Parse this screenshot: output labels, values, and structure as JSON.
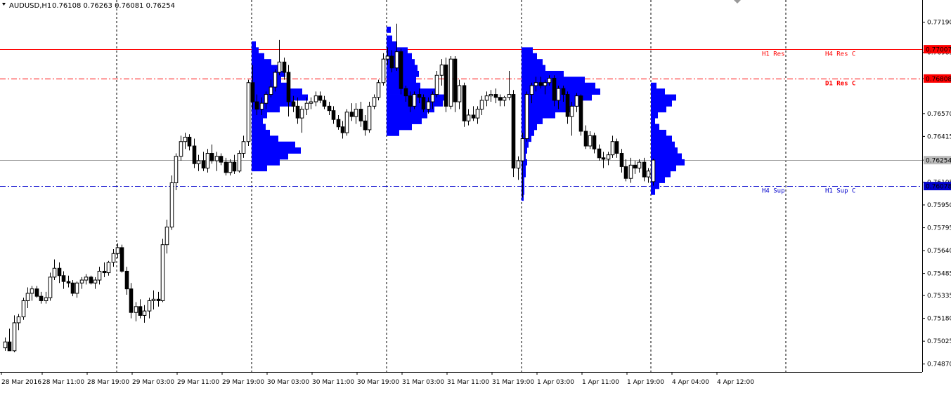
{
  "header": {
    "symbol": "AUDUSD,H1",
    "ohlc": "0.76108 0.76263 0.76081 0.76254"
  },
  "colors": {
    "up_body": "#ffffff",
    "down_body": "#000000",
    "profile": "#0000ff",
    "resistance": "#ff0000",
    "support": "#0000cc",
    "last_price_line": "#999999",
    "session_grid": "#000000"
  },
  "chart_data": {
    "type": "candlestick",
    "timeframe": "H1",
    "ylim": [
      0.7474,
      0.7726
    ],
    "y_ticks": [
      "0.77190",
      "0.76985",
      "0.76808",
      "0.76570",
      "0.76415",
      "0.76254",
      "0.76105",
      "0.75950",
      "0.75795",
      "0.75640",
      "0.75485",
      "0.75335",
      "0.75180",
      "0.75025",
      "0.74870"
    ],
    "x_ticks": [
      "28 Mar 2016",
      "28 Mar 11:00",
      "28 Mar 19:00",
      "29 Mar 03:00",
      "29 Mar 11:00",
      "29 Mar 19:00",
      "30 Mar 03:00",
      "30 Mar 11:00",
      "30 Mar 19:00",
      "31 Mar 03:00",
      "31 Mar 11:00",
      "31 Mar 19:00",
      "1 Apr 03:00",
      "1 Apr 11:00",
      "1 Apr 19:00",
      "4 Apr 04:00",
      "4 Apr 12:00"
    ],
    "session_separators_hour_index": [
      24,
      48,
      72,
      96,
      120,
      144
    ],
    "levels": [
      {
        "price": 0.77007,
        "badge": "0.77007",
        "style": "solid",
        "color": "#ff0000",
        "labels": [
          "H1 Res",
          "H4 Res C"
        ]
      },
      {
        "price": 0.76808,
        "badge": "0.76808",
        "style": "dashdot",
        "color": "#ff0000",
        "labels": [
          "D1 Res C"
        ]
      },
      {
        "price": 0.76254,
        "badge": "0.76254",
        "style": "solid",
        "color": "#999999",
        "labels": []
      },
      {
        "price": 0.76078,
        "badge": "0.76078",
        "style": "dashdot",
        "color": "#0000cc",
        "labels": [
          "H4 Sup",
          "H1 Sup C"
        ]
      }
    ],
    "candles": [
      [
        0.7498,
        0.7505,
        0.7496,
        0.7502
      ],
      [
        0.7502,
        0.7511,
        0.75,
        0.7496
      ],
      [
        0.7496,
        0.752,
        0.7495,
        0.7515
      ],
      [
        0.7515,
        0.7521,
        0.751,
        0.7519
      ],
      [
        0.7519,
        0.7532,
        0.7517,
        0.753
      ],
      [
        0.753,
        0.7539,
        0.7525,
        0.7535
      ],
      [
        0.7535,
        0.754,
        0.753,
        0.7538
      ],
      [
        0.7538,
        0.754,
        0.7532,
        0.7533
      ],
      [
        0.7533,
        0.7536,
        0.7528,
        0.753
      ],
      [
        0.753,
        0.7536,
        0.7528,
        0.7532
      ],
      [
        0.7532,
        0.7549,
        0.753,
        0.7546
      ],
      [
        0.7546,
        0.7558,
        0.7544,
        0.7552
      ],
      [
        0.7552,
        0.7556,
        0.7542,
        0.7547
      ],
      [
        0.7547,
        0.755,
        0.7538,
        0.7543
      ],
      [
        0.7543,
        0.7547,
        0.7539,
        0.7542
      ],
      [
        0.7542,
        0.7544,
        0.7533,
        0.7535
      ],
      [
        0.7535,
        0.7543,
        0.7532,
        0.7542
      ],
      [
        0.7542,
        0.7546,
        0.7538,
        0.7544
      ],
      [
        0.7544,
        0.7548,
        0.7541,
        0.7546
      ],
      [
        0.7546,
        0.7547,
        0.7541,
        0.7542
      ],
      [
        0.7542,
        0.7546,
        0.7538,
        0.7544
      ],
      [
        0.7544,
        0.7553,
        0.7541,
        0.755
      ],
      [
        0.755,
        0.7556,
        0.7546,
        0.7549
      ],
      [
        0.7549,
        0.7557,
        0.7547,
        0.7556
      ],
      [
        0.7556,
        0.7565,
        0.7553,
        0.7562
      ],
      [
        0.7562,
        0.7569,
        0.7559,
        0.7566
      ],
      [
        0.7566,
        0.7568,
        0.7549,
        0.755
      ],
      [
        0.755,
        0.7553,
        0.7534,
        0.7538
      ],
      [
        0.7538,
        0.7542,
        0.7518,
        0.7522
      ],
      [
        0.7522,
        0.7529,
        0.7516,
        0.7526
      ],
      [
        0.7526,
        0.7531,
        0.7518,
        0.752
      ],
      [
        0.752,
        0.7527,
        0.7515,
        0.7523
      ],
      [
        0.7523,
        0.7532,
        0.7518,
        0.753
      ],
      [
        0.753,
        0.7537,
        0.7524,
        0.7531
      ],
      [
        0.7531,
        0.7536,
        0.7526,
        0.753
      ],
      [
        0.753,
        0.7572,
        0.7529,
        0.7568
      ],
      [
        0.7568,
        0.7585,
        0.7562,
        0.758
      ],
      [
        0.758,
        0.7615,
        0.7578,
        0.761
      ],
      [
        0.761,
        0.763,
        0.7605,
        0.7628
      ],
      [
        0.7628,
        0.7642,
        0.7625,
        0.7638
      ],
      [
        0.7638,
        0.7644,
        0.7633,
        0.7641
      ],
      [
        0.7641,
        0.7643,
        0.7632,
        0.7635
      ],
      [
        0.7635,
        0.764,
        0.762,
        0.7623
      ],
      [
        0.7623,
        0.7629,
        0.7618,
        0.7625
      ],
      [
        0.7625,
        0.7631,
        0.7618,
        0.762
      ],
      [
        0.762,
        0.7633,
        0.7617,
        0.763
      ],
      [
        0.763,
        0.7636,
        0.7623,
        0.7625
      ],
      [
        0.7625,
        0.7631,
        0.7618,
        0.7628
      ],
      [
        0.7628,
        0.763,
        0.7622,
        0.7624
      ],
      [
        0.7624,
        0.7627,
        0.7615,
        0.7617
      ],
      [
        0.7617,
        0.7626,
        0.7615,
        0.7624
      ],
      [
        0.7624,
        0.7629,
        0.7616,
        0.7618
      ],
      [
        0.7618,
        0.7632,
        0.7617,
        0.763
      ],
      [
        0.763,
        0.7642,
        0.7627,
        0.7638
      ],
      [
        0.7638,
        0.768,
        0.7635,
        0.7678
      ],
      [
        0.7678,
        0.769,
        0.766,
        0.7665
      ],
      [
        0.7665,
        0.767,
        0.7656,
        0.766
      ],
      [
        0.766,
        0.7668,
        0.7656,
        0.7664
      ],
      [
        0.7664,
        0.7672,
        0.766,
        0.767
      ],
      [
        0.767,
        0.768,
        0.7668,
        0.7675
      ],
      [
        0.7675,
        0.7687,
        0.7672,
        0.7685
      ],
      [
        0.7685,
        0.7707,
        0.7683,
        0.7692
      ],
      [
        0.7692,
        0.7695,
        0.768,
        0.7685
      ],
      [
        0.7685,
        0.769,
        0.7655,
        0.7665
      ],
      [
        0.7665,
        0.7669,
        0.7658,
        0.7662
      ],
      [
        0.7662,
        0.7668,
        0.765,
        0.7654
      ],
      [
        0.7654,
        0.7662,
        0.7644,
        0.766
      ],
      [
        0.766,
        0.7668,
        0.7656,
        0.7664
      ],
      [
        0.7664,
        0.7668,
        0.766,
        0.7665
      ],
      [
        0.7665,
        0.7672,
        0.7662,
        0.7669
      ],
      [
        0.7669,
        0.7672,
        0.7664,
        0.7666
      ],
      [
        0.7666,
        0.7669,
        0.766,
        0.7662
      ],
      [
        0.7662,
        0.7665,
        0.7656,
        0.7659
      ],
      [
        0.7659,
        0.7662,
        0.765,
        0.7653
      ],
      [
        0.7653,
        0.7656,
        0.7646,
        0.7648
      ],
      [
        0.7648,
        0.7652,
        0.764,
        0.7644
      ],
      [
        0.7644,
        0.766,
        0.7642,
        0.7658
      ],
      [
        0.7658,
        0.7664,
        0.7652,
        0.7655
      ],
      [
        0.7655,
        0.7664,
        0.765,
        0.766
      ],
      [
        0.766,
        0.7665,
        0.7648,
        0.7652
      ],
      [
        0.7652,
        0.7656,
        0.7642,
        0.7646
      ],
      [
        0.7646,
        0.7665,
        0.7644,
        0.7662
      ],
      [
        0.7662,
        0.767,
        0.766,
        0.7668
      ],
      [
        0.7668,
        0.768,
        0.7666,
        0.7678
      ],
      [
        0.7678,
        0.7698,
        0.7676,
        0.7694
      ],
      [
        0.7694,
        0.7702,
        0.769,
        0.7696
      ],
      [
        0.7696,
        0.77,
        0.7685,
        0.7688
      ],
      [
        0.7688,
        0.7718,
        0.7686,
        0.7699
      ],
      [
        0.7699,
        0.7701,
        0.767,
        0.7674
      ],
      [
        0.7674,
        0.7676,
        0.7665,
        0.7669
      ],
      [
        0.7669,
        0.7672,
        0.7658,
        0.7662
      ],
      [
        0.7662,
        0.7672,
        0.766,
        0.767
      ],
      [
        0.767,
        0.7674,
        0.7664,
        0.7668
      ],
      [
        0.7668,
        0.767,
        0.7658,
        0.766
      ],
      [
        0.766,
        0.7668,
        0.7657,
        0.7665
      ],
      [
        0.7665,
        0.7672,
        0.766,
        0.767
      ],
      [
        0.767,
        0.7686,
        0.7668,
        0.7683
      ],
      [
        0.7683,
        0.7694,
        0.7676,
        0.769
      ],
      [
        0.769,
        0.7695,
        0.7658,
        0.7662
      ],
      [
        0.7662,
        0.7696,
        0.766,
        0.7694
      ],
      [
        0.7694,
        0.7696,
        0.7658,
        0.7665
      ],
      [
        0.7665,
        0.768,
        0.766,
        0.7676
      ],
      [
        0.7676,
        0.7678,
        0.7648,
        0.7652
      ],
      [
        0.7652,
        0.766,
        0.7649,
        0.7656
      ],
      [
        0.7656,
        0.7662,
        0.7652,
        0.7654
      ],
      [
        0.7654,
        0.7662,
        0.765,
        0.766
      ],
      [
        0.766,
        0.7669,
        0.7656,
        0.7666
      ],
      [
        0.7666,
        0.7672,
        0.7662,
        0.7669
      ],
      [
        0.7669,
        0.7673,
        0.7665,
        0.767
      ],
      [
        0.767,
        0.7674,
        0.7664,
        0.7668
      ],
      [
        0.7668,
        0.767,
        0.7662,
        0.7666
      ],
      [
        0.7666,
        0.7669,
        0.7662,
        0.7668
      ],
      [
        0.7668,
        0.7686,
        0.7666,
        0.767
      ],
      [
        0.767,
        0.7673,
        0.7614,
        0.762
      ],
      [
        0.762,
        0.7628,
        0.7612,
        0.7625
      ],
      [
        0.7625,
        0.7644,
        0.76,
        0.764
      ],
      [
        0.764,
        0.7672,
        0.7638,
        0.767
      ],
      [
        0.767,
        0.7678,
        0.7664,
        0.7676
      ],
      [
        0.7676,
        0.7682,
        0.7672,
        0.7678
      ],
      [
        0.7678,
        0.7682,
        0.7674,
        0.7676
      ],
      [
        0.7676,
        0.768,
        0.767,
        0.7678
      ],
      [
        0.7678,
        0.7683,
        0.7676,
        0.7681
      ],
      [
        0.7681,
        0.7683,
        0.7662,
        0.7666
      ],
      [
        0.7666,
        0.7676,
        0.766,
        0.7674
      ],
      [
        0.7674,
        0.7676,
        0.7665,
        0.767
      ],
      [
        0.767,
        0.7672,
        0.765,
        0.7655
      ],
      [
        0.7655,
        0.7665,
        0.7642,
        0.7662
      ],
      [
        0.7662,
        0.7671,
        0.7658,
        0.7669
      ],
      [
        0.7669,
        0.767,
        0.7642,
        0.7645
      ],
      [
        0.7645,
        0.7649,
        0.7633,
        0.7635
      ],
      [
        0.7635,
        0.7645,
        0.7633,
        0.7642
      ],
      [
        0.7642,
        0.7644,
        0.763,
        0.7633
      ],
      [
        0.7633,
        0.7636,
        0.7625,
        0.7627
      ],
      [
        0.7627,
        0.7631,
        0.762,
        0.7626
      ],
      [
        0.7626,
        0.7631,
        0.7622,
        0.7629
      ],
      [
        0.7629,
        0.7642,
        0.7627,
        0.7638
      ],
      [
        0.7638,
        0.764,
        0.7627,
        0.763
      ],
      [
        0.763,
        0.7633,
        0.7617,
        0.7621
      ],
      [
        0.7621,
        0.7626,
        0.7611,
        0.7613
      ],
      [
        0.7613,
        0.7627,
        0.761,
        0.7622
      ],
      [
        0.7622,
        0.7625,
        0.7616,
        0.762
      ],
      [
        0.762,
        0.7626,
        0.7617,
        0.7624
      ],
      [
        0.7624,
        0.7627,
        0.7611,
        0.7614
      ],
      [
        0.7614,
        0.762,
        0.761,
        0.7618
      ],
      [
        0.76108,
        0.76263,
        0.76081,
        0.76254
      ]
    ],
    "volume_profiles": [
      {
        "session": 1,
        "bars": [
          [
            0.7704,
            6
          ],
          [
            0.77,
            10
          ],
          [
            0.7696,
            18
          ],
          [
            0.7692,
            28
          ],
          [
            0.7688,
            40
          ],
          [
            0.7684,
            48
          ],
          [
            0.768,
            42
          ],
          [
            0.7676,
            55
          ],
          [
            0.7672,
            72
          ],
          [
            0.7668,
            80
          ],
          [
            0.7664,
            60
          ],
          [
            0.766,
            40
          ],
          [
            0.7656,
            22
          ],
          [
            0.7652,
            16
          ],
          [
            0.7648,
            20
          ],
          [
            0.7644,
            26
          ],
          [
            0.764,
            38
          ],
          [
            0.7636,
            62
          ],
          [
            0.7632,
            70
          ],
          [
            0.7628,
            52
          ],
          [
            0.7624,
            40
          ],
          [
            0.762,
            22
          ]
        ]
      },
      {
        "session": 2,
        "bars": [
          [
            0.7714,
            6
          ],
          [
            0.7708,
            8
          ],
          [
            0.7704,
            14
          ],
          [
            0.77,
            30
          ],
          [
            0.7696,
            36
          ],
          [
            0.7692,
            40
          ],
          [
            0.7688,
            44
          ],
          [
            0.7684,
            46
          ],
          [
            0.768,
            42
          ],
          [
            0.7676,
            48
          ],
          [
            0.7672,
            72
          ],
          [
            0.7668,
            84
          ],
          [
            0.7664,
            80
          ],
          [
            0.766,
            68
          ],
          [
            0.7656,
            58
          ],
          [
            0.7652,
            50
          ],
          [
            0.7648,
            36
          ],
          [
            0.7644,
            18
          ]
        ]
      },
      {
        "session": 3,
        "bars": [
          [
            0.77,
            16
          ],
          [
            0.7696,
            22
          ],
          [
            0.7692,
            30
          ],
          [
            0.7688,
            34
          ],
          [
            0.7684,
            60
          ],
          [
            0.768,
            90
          ],
          [
            0.7676,
            105
          ],
          [
            0.7672,
            112
          ],
          [
            0.7668,
            100
          ],
          [
            0.7664,
            86
          ],
          [
            0.766,
            70
          ],
          [
            0.7656,
            48
          ],
          [
            0.7652,
            30
          ],
          [
            0.7648,
            22
          ],
          [
            0.7644,
            18
          ],
          [
            0.764,
            14
          ],
          [
            0.7636,
            10
          ],
          [
            0.7632,
            8
          ],
          [
            0.7628,
            6
          ],
          [
            0.7624,
            8
          ],
          [
            0.762,
            6
          ],
          [
            0.7616,
            6
          ],
          [
            0.7612,
            4
          ],
          [
            0.7608,
            4
          ],
          [
            0.7604,
            4
          ],
          [
            0.76,
            3
          ]
        ]
      },
      {
        "session": 4,
        "bars": [
          [
            0.7676,
            8
          ],
          [
            0.7672,
            20
          ],
          [
            0.7668,
            36
          ],
          [
            0.7664,
            30
          ],
          [
            0.766,
            22
          ],
          [
            0.7656,
            10
          ],
          [
            0.7652,
            6
          ],
          [
            0.7648,
            12
          ],
          [
            0.7644,
            22
          ],
          [
            0.764,
            30
          ],
          [
            0.7636,
            34
          ],
          [
            0.7632,
            38
          ],
          [
            0.7628,
            44
          ],
          [
            0.7624,
            48
          ],
          [
            0.762,
            36
          ],
          [
            0.7616,
            28
          ],
          [
            0.7612,
            20
          ],
          [
            0.7608,
            12
          ],
          [
            0.7604,
            6
          ]
        ]
      }
    ]
  }
}
